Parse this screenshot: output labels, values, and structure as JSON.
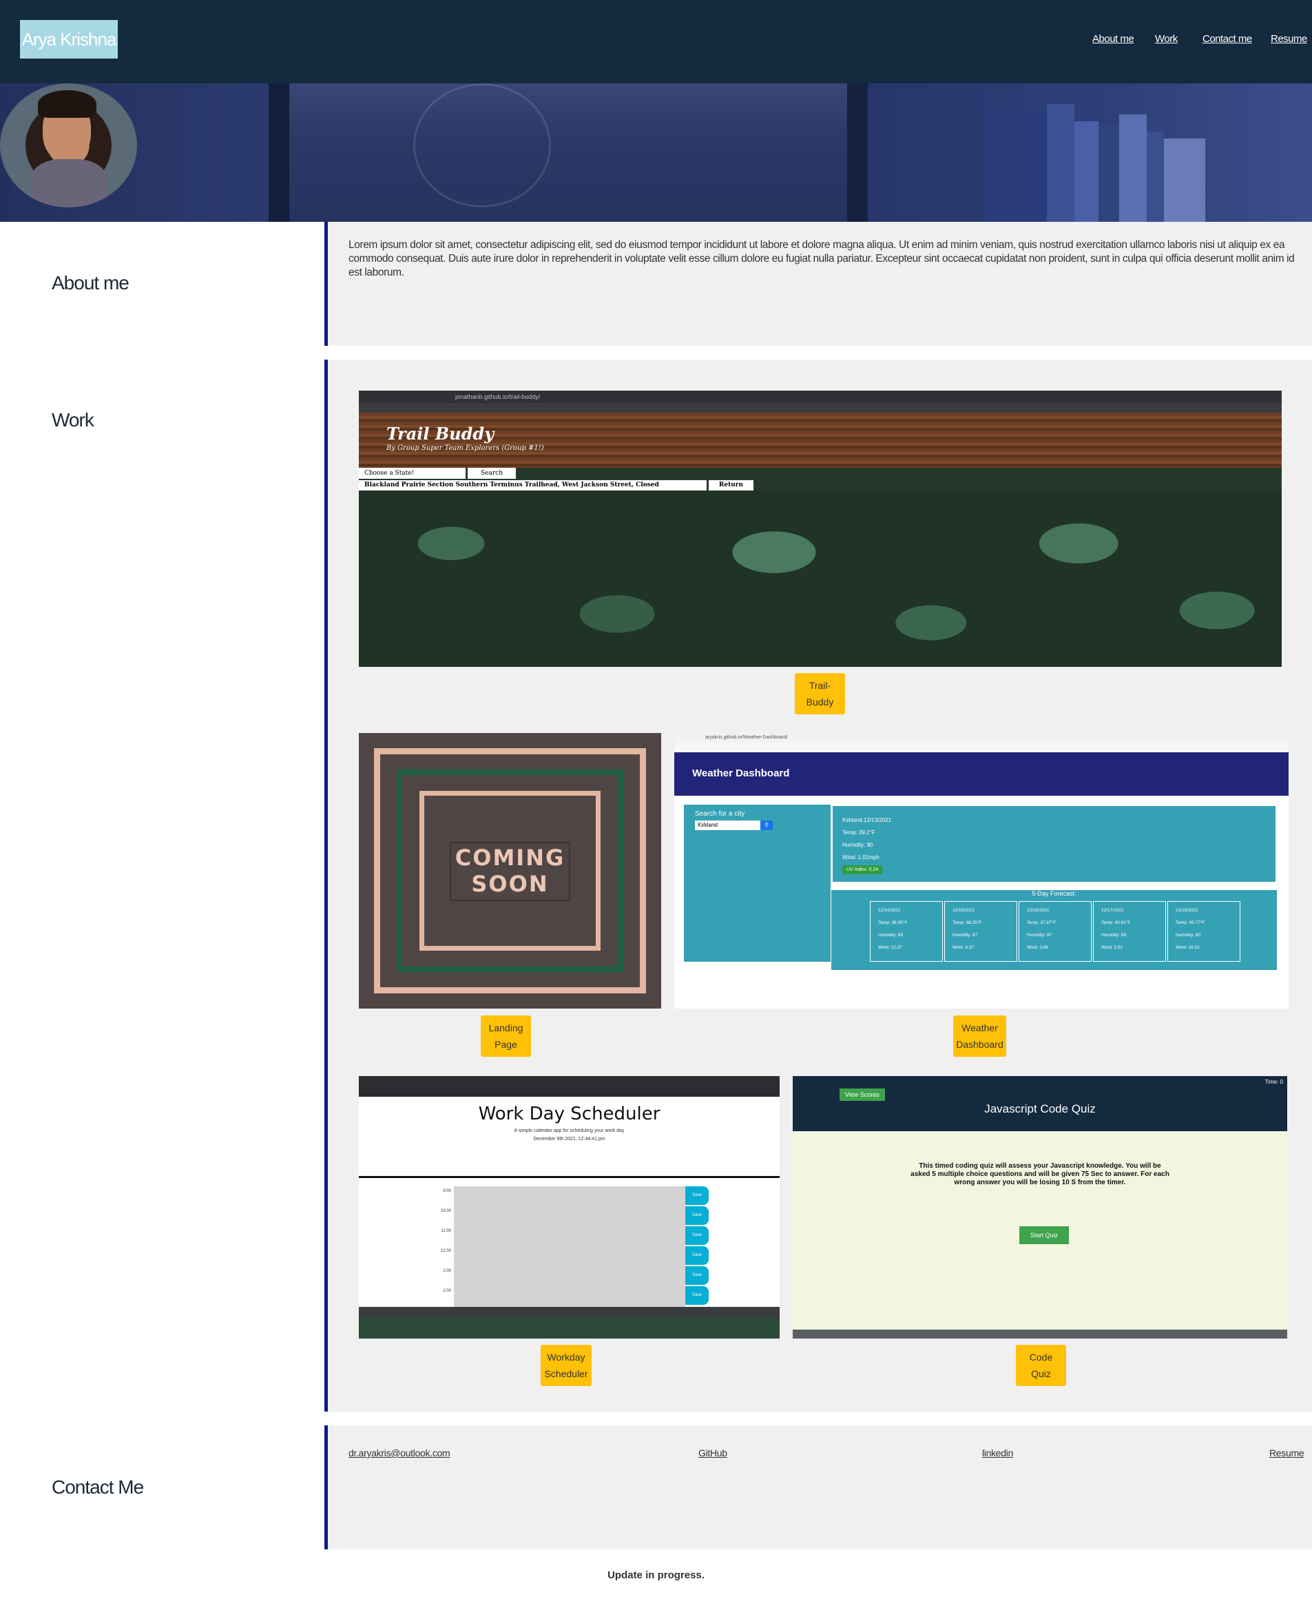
{
  "header": {
    "logo": "Arya Krishna",
    "nav": [
      "About me",
      "Work",
      "Contact me",
      "Resume"
    ]
  },
  "about": {
    "heading": "About me",
    "text": "Lorem ipsum dolor sit amet, consectetur adipiscing elit, sed do eiusmod tempor incididunt ut labore et dolore magna aliqua. Ut enim ad minim veniam, quis nostrud exercitation ullamco laboris nisi ut aliquip ex ea commodo consequat. Duis aute irure dolor in reprehenderit in voluptate velit esse cillum dolore eu fugiat nulla pariatur. Excepteur sint occaecat cupidatat non proident, sunt in culpa qui officia deserunt mollit anim id est laborum."
  },
  "work": {
    "heading": "Work",
    "projects": [
      {
        "label_line1": "Trail-",
        "label_line2": "Buddy"
      },
      {
        "label_line1": "Landing",
        "label_line2": "Page"
      },
      {
        "label_line1": "Weather",
        "label_line2": "Dashboard"
      },
      {
        "label_line1": "Workday",
        "label_line2": "Scheduler"
      },
      {
        "label_line1": "Code",
        "label_line2": "Quiz"
      }
    ],
    "trail": {
      "url": "jonathanb.github.io/trail-buddy/",
      "title": "Trail Buddy",
      "subtitle": "By Group Super Team Explorers (Group #1!)",
      "state_placeholder": "Choose a State!",
      "search": "Search",
      "result": "Blackland Prairie Section Southern Terminus Trailhead, West Jackson Street, Closed",
      "return": "Return"
    },
    "coming": {
      "line1": "COMING",
      "line2": "SOON"
    },
    "weather": {
      "url": "aryakris.github.io/Weather-Dashboard/",
      "title": "Weather Dashboard",
      "search_label": "Search for a city",
      "search_value": "Kirkland",
      "current_city": "Kirkland 12/13/2021",
      "temp": "Temp: 39.2°F",
      "humidity": "Humidity: 90",
      "wind": "Wind: 1.01mph",
      "uv": "UV Index: 0.24",
      "forecast_title": "5-Day Forecast:",
      "forecast": [
        {
          "date": "12/14/2021",
          "temp": "Temp: 36.95°F",
          "hum": "Humidity: 85",
          "wind": "Wind: 12.37"
        },
        {
          "date": "12/15/2021",
          "temp": "Temp: 38.25°F",
          "hum": "Humidity: 87",
          "wind": "Wind: 8.37"
        },
        {
          "date": "12/16/2021",
          "temp": "Temp: 37.67°F",
          "hum": "Humidity: 97",
          "wind": "Wind: 3.86"
        },
        {
          "date": "12/17/2021",
          "temp": "Temp: 40.91°F",
          "hum": "Humidity: 69",
          "wind": "Wind: 3.52"
        },
        {
          "date": "12/18/2021",
          "temp": "Temp: 45.77°F",
          "hum": "Humidity: 80",
          "wind": "Wind: 16.02"
        }
      ]
    },
    "scheduler": {
      "title": "Work Day Scheduler",
      "subtitle": "A simple calendar app for scheduling your work day",
      "date": "December 8th 2021, 12:44:41 pm",
      "hours": [
        "9:00",
        "10:00",
        "11:00",
        "12:00",
        "1:00",
        "2:00"
      ],
      "save": "Save"
    },
    "quiz": {
      "view_scores": "View Scores",
      "time": "Time: 0",
      "title": "Javascript Code Quiz",
      "desc": "This timed coding quiz will assess your Javascript knowledge. You will be asked 5 multiple choice questions and will be given 75 Sec to answer. For each wrong answer you will be losing 10 S from the timer.",
      "start": "Start Quiz"
    }
  },
  "contact": {
    "heading": "Contact Me",
    "email": "dr.aryakris@outlook.com",
    "github": "GitHub",
    "linkedin": "linkedin",
    "resume": "Resume"
  },
  "footer": "Update in progress.",
  "colors": {
    "header_bg": "#142a3f",
    "logo_bg": "#a8d8e4",
    "panel_bg": "#f0f0f0",
    "panel_border": "#0d1a8a",
    "button": "#ffc107"
  }
}
